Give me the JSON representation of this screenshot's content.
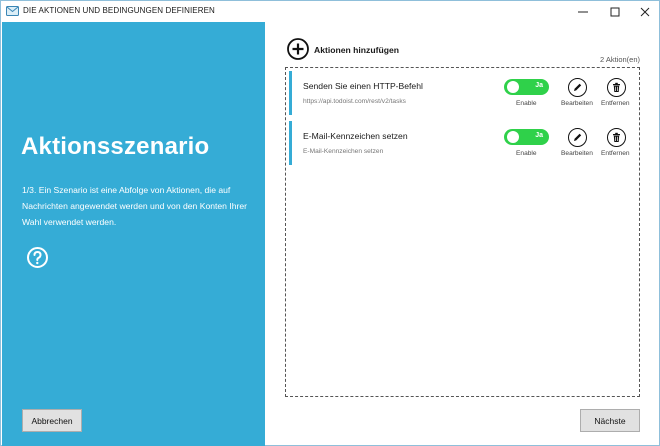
{
  "window": {
    "title": "DIE AKTIONEN UND BEDINGUNGEN DEFINIEREN",
    "controls": {
      "minimize": "—",
      "maximize": "☐",
      "close": "✕"
    }
  },
  "left_panel": {
    "background": "#35acd6",
    "title": "Aktionsszenario",
    "description": "1/3. Ein Szenario ist eine Abfolge von Aktionen, die auf Nachrichten angewendet werden und von den Konten Ihrer Wahl verwendet werden.",
    "help_icon": "question-circle-icon",
    "cancel_label": "Abbrechen"
  },
  "right_panel": {
    "add_label": "Aktionen hinzufügen",
    "count_label": "2 Aktion(en)",
    "actions": [
      {
        "title": "Senden Sie einen HTTP-Befehl",
        "subtitle": "https://api.todoist.com/rest/v2/tasks",
        "toggle_label": "Ja",
        "toggle_on": true,
        "enable_caption": "Enable",
        "edit_caption": "Bearbeiten",
        "remove_caption": "Entfernen"
      },
      {
        "title": "E-Mail-Kennzeichen setzen",
        "subtitle": "E-Mail-Kennzeichen setzen",
        "toggle_label": "Ja",
        "toggle_on": true,
        "enable_caption": "Enable",
        "edit_caption": "Bearbeiten",
        "remove_caption": "Entfernen"
      }
    ],
    "next_label": "Nächste"
  },
  "colors": {
    "accent": "#35acd6",
    "toggle_on": "#2fd14a"
  }
}
